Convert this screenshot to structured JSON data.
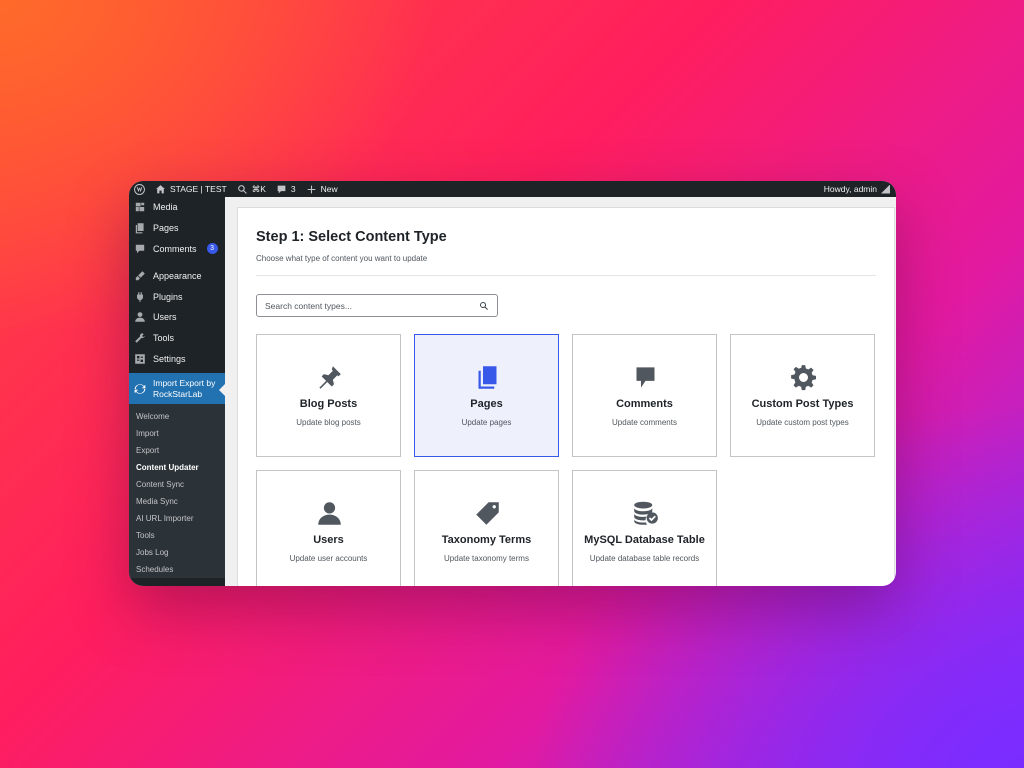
{
  "admin_bar": {
    "site_name": "STAGE | TEST",
    "search_shortcut": "⌘K",
    "comments_count": "3",
    "new_label": "New",
    "greeting": "Howdy, admin"
  },
  "sidebar": {
    "items": [
      {
        "label": "Media",
        "icon": "media-icon"
      },
      {
        "label": "Pages",
        "icon": "pages-icon"
      },
      {
        "label": "Comments",
        "icon": "comments-icon",
        "badge": "3"
      }
    ],
    "items2": [
      {
        "label": "Appearance",
        "icon": "appearance-icon"
      },
      {
        "label": "Plugins",
        "icon": "plugins-icon"
      },
      {
        "label": "Users",
        "icon": "users-icon"
      },
      {
        "label": "Tools",
        "icon": "tools-icon"
      },
      {
        "label": "Settings",
        "icon": "settings-icon"
      }
    ],
    "active": {
      "line1": "Import Export by",
      "line2": "RockStarLab"
    },
    "submenu": [
      "Welcome",
      "Import",
      "Export",
      "Content Updater",
      "Content Sync",
      "Media Sync",
      "AI URL Importer",
      "Tools",
      "Jobs Log",
      "Schedules"
    ],
    "current_submenu": "Content Updater"
  },
  "main": {
    "title": "Step 1: Select Content Type",
    "subtitle": "Choose what type of content you want to update",
    "search_placeholder": "Search content types...",
    "cards": [
      {
        "title": "Blog Posts",
        "desc": "Update blog posts",
        "icon": "pin-icon"
      },
      {
        "title": "Pages",
        "desc": "Update pages",
        "icon": "pages-icon",
        "selected": true
      },
      {
        "title": "Comments",
        "desc": "Update comments",
        "icon": "comment-icon"
      },
      {
        "title": "Custom Post Types",
        "desc": "Update custom post types",
        "icon": "gear-icon"
      },
      {
        "title": "Users",
        "desc": "Update user accounts",
        "icon": "user-icon"
      },
      {
        "title": "Taxonomy Terms",
        "desc": "Update taxonomy terms",
        "icon": "tag-icon"
      },
      {
        "title": "MySQL Database Table",
        "desc": "Update database table records",
        "icon": "database-icon"
      }
    ]
  },
  "colors": {
    "accent": "#3858e9",
    "admin_bar": "#1d2327",
    "sidebar_active": "#2271b1",
    "selected_card_bg": "#eef0fc"
  }
}
